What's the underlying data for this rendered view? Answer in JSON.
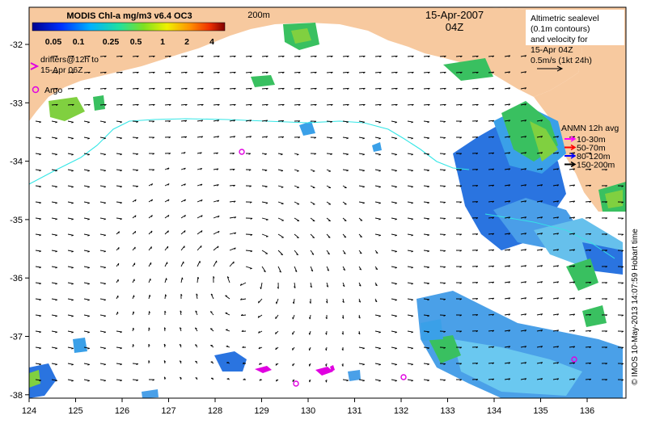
{
  "colorbar": {
    "title": "MODIS Chl-a mg/m3 v6.4 OC3",
    "ticks": [
      "0.05",
      "0.1",
      "0.25",
      "0.5",
      "1",
      "2",
      "4"
    ]
  },
  "map": {
    "date": "15-Apr-2007",
    "time": "04Z",
    "isobath_label": "200m",
    "credit": "© IMOS 10-May-2013 14:07:59 Hobart time",
    "x_ticks": [
      "124",
      "125",
      "126",
      "127",
      "128",
      "129",
      "130",
      "131",
      "132",
      "133",
      "134",
      "135",
      "136"
    ],
    "y_ticks": [
      "-32",
      "-33",
      "-34",
      "-35",
      "-36",
      "-37",
      "-38"
    ]
  },
  "legend": {
    "drifters": [
      "drifters@12h to",
      "15-Apr 06Z"
    ],
    "argo": "Argo",
    "altimetry": [
      "Altimetric sealevel",
      "(0.1m contours)",
      "and velocity for",
      "15-Apr 04Z",
      "0.5m/s (1kt 24h)"
    ],
    "anmn_title": "ANMN 12h avg",
    "anmn_items": [
      {
        "label": "10-30m",
        "color": "#ff00ff"
      },
      {
        "label": "50-70m",
        "color": "#ff0000"
      },
      {
        "label": "80-120m",
        "color": "#0000ff"
      },
      {
        "label": "150-200m",
        "color": "#000000"
      }
    ]
  },
  "colors": {
    "land": "#f7c99f",
    "isobath": "#33e6e6",
    "argo": "#e000e0",
    "arrow": "#000000"
  }
}
